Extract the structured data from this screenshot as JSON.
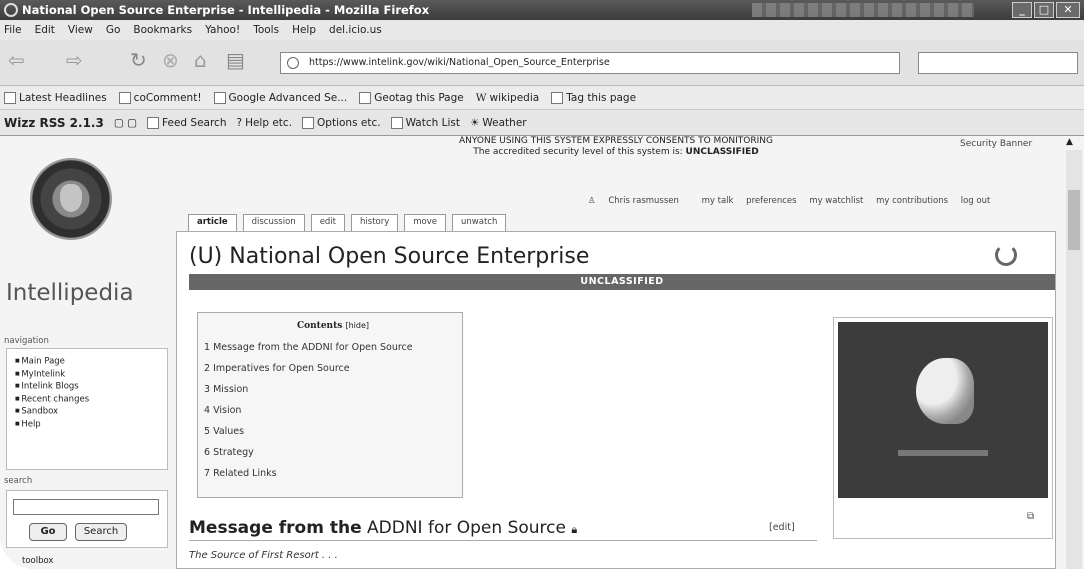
{
  "window": {
    "title": "National Open Source Enterprise - Intellipedia - Mozilla Firefox"
  },
  "menu": [
    "File",
    "Edit",
    "View",
    "Go",
    "Bookmarks",
    "Yahoo!",
    "Tools",
    "Help",
    "del.icio.us"
  ],
  "nav": {
    "url": "https://www.intelink.gov/wiki/National_Open_Source_Enterprise",
    "search_placeholder": ""
  },
  "bookmarks": [
    "Latest Headlines",
    "coComment!",
    "Google Advanced Se...",
    "Geotag this Page",
    "wikipedia",
    "Tag this page"
  ],
  "rssbar": {
    "title": "Wizz RSS 2.1.3",
    "items": [
      "Feed Search",
      "Help etc.",
      "Options etc.",
      "Watch List",
      "Weather"
    ]
  },
  "banner": {
    "line1": "ANYONE USING THIS SYSTEM EXPRESSLY CONSENTS TO MONITORING",
    "line2_prefix": "The accredited security level of this system is:",
    "line2_level": "UNCLASSIFIED",
    "security_link": "Security Banner"
  },
  "personal": [
    "Chris rasmussen",
    "my talk",
    "preferences",
    "my watchlist",
    "my contributions",
    "log out"
  ],
  "tabs": [
    "article",
    "discussion",
    "edit",
    "history",
    "move",
    "unwatch"
  ],
  "sidebar": {
    "brand": "Intellipedia",
    "nav_heading": "navigation",
    "nav_items": [
      "Main Page",
      "MyIntelink",
      "Intelink Blogs",
      "Recent changes",
      "Sandbox",
      "Help"
    ],
    "search_heading": "search",
    "go_label": "Go",
    "search_label": "Search",
    "toolbox_heading": "toolbox"
  },
  "article": {
    "title": "(U) National Open Source Enterprise",
    "classification": "UNCLASSIFIED",
    "toc_title": "Contents",
    "toc_hide": "[hide]",
    "toc": [
      "1 Message from the ADDNI for Open Source",
      "2 Imperatives for Open Source",
      "3 Mission",
      "4 Vision",
      "5 Values",
      "6 Strategy",
      "7 Related Links"
    ],
    "section_title_a": "Message from the",
    "section_title_b": "ADDNI for Open Source",
    "edit_link": "[edit]",
    "subtitle": "The Source of First Resort . . ."
  }
}
